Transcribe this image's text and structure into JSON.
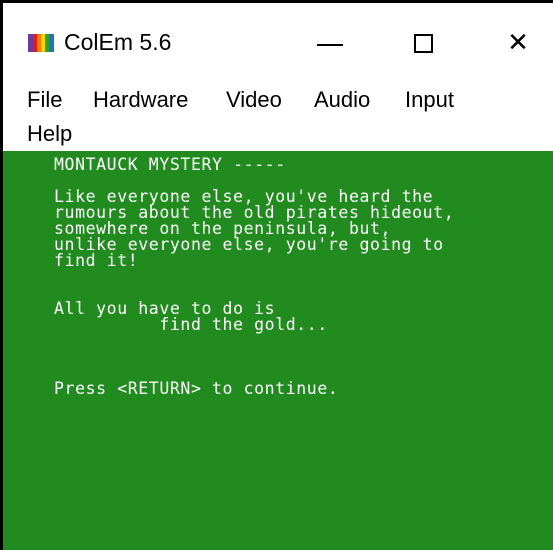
{
  "window": {
    "title": "ColEm 5.6",
    "icon": "colem-app-icon",
    "controls": {
      "minimize": "minimize-icon",
      "maximize": "maximize-icon",
      "close": "close-icon",
      "close_glyph": "✕"
    }
  },
  "menu": {
    "items": [
      "File",
      "Hardware",
      "Video",
      "Audio",
      "Input",
      "Help"
    ]
  },
  "screen": {
    "background": "#228b1f",
    "text_color": "#ffffff",
    "lines": [
      "MONTAUCK MYSTERY -----",
      "Like everyone else, you've heard the",
      "rumours about the old pirates hideout,",
      "somewhere on the peninsula, but,",
      "unlike everyone else, you're going to",
      "find it!",
      "All you have to do is",
      "          find the gold...",
      "Press <RETURN> to continue."
    ]
  }
}
